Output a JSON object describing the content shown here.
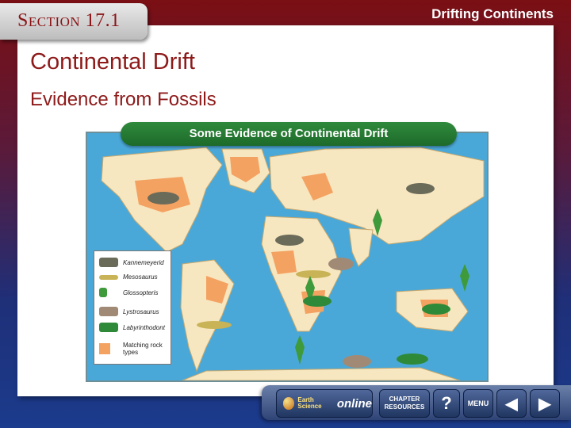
{
  "header": {
    "section_label": "Section 17.1",
    "topic": "Drifting Continents"
  },
  "content": {
    "title": "Continental Drift",
    "subtitle": "Evidence from Fossils"
  },
  "figure": {
    "banner": "Some Evidence of Continental Drift",
    "legend": [
      {
        "label": "Kannemeyerid",
        "icon": "kannemeyerid-icon",
        "color": "#6b6b5a"
      },
      {
        "label": "Mesosaurus",
        "icon": "mesosaurus-icon",
        "color": "#c9b357"
      },
      {
        "label": "Glossopteris",
        "icon": "glossopteris-icon",
        "color": "#3e9a3a"
      },
      {
        "label": "Lystrosaurus",
        "icon": "lystrosaurus-icon",
        "color": "#a08a75"
      },
      {
        "label": "Labyrinthodont",
        "icon": "labyrinthodont-icon",
        "color": "#2e8a38"
      },
      {
        "label": "Matching rock types",
        "icon": "matching-rock-swatch",
        "color": "#f4a261"
      }
    ]
  },
  "nav": {
    "earth_label": "Earth Science",
    "online_label": "online",
    "chapter_label": "CHAPTER RESOURCES",
    "help_label": "?",
    "menu_label": "MENU",
    "prev_label": "◀",
    "next_label": "▶"
  },
  "colors": {
    "accent": "#8e1a1a",
    "ocean": "#4aa8d8",
    "land": "#f7e7c0",
    "rock": "#f4a261"
  }
}
